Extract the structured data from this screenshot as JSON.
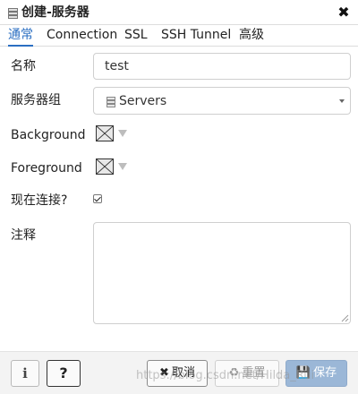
{
  "dialog": {
    "title": "创建-服务器",
    "title_icon": "server-icon",
    "close_glyph": "✖"
  },
  "tabs": [
    {
      "label": "通常",
      "active": true
    },
    {
      "label": "Connection",
      "active": false
    },
    {
      "label": "SSL",
      "active": false
    },
    {
      "label": "SSH Tunnel",
      "active": false
    },
    {
      "label": "高级",
      "active": false
    }
  ],
  "form": {
    "name_label": "名称",
    "name_value": "test",
    "group_label": "服务器组",
    "group_value": "Servers",
    "background_label": "Background",
    "foreground_label": "Foreground",
    "connect_now_label": "现在连接?",
    "connect_now_checked": true,
    "comments_label": "注释",
    "comments_value": ""
  },
  "footer": {
    "info_label": "i",
    "help_label": "?",
    "cancel_icon": "✖",
    "cancel_label": "取消",
    "reset_icon": "♻",
    "reset_label": "重置",
    "save_icon": "💾",
    "save_label": "保存"
  },
  "watermark": "https://blog.csdn.net/Hilda_Rui",
  "colors": {
    "accent": "#2b6fc2",
    "save_button": "#9bb7d7",
    "footer_bg": "#f3f3f3"
  }
}
